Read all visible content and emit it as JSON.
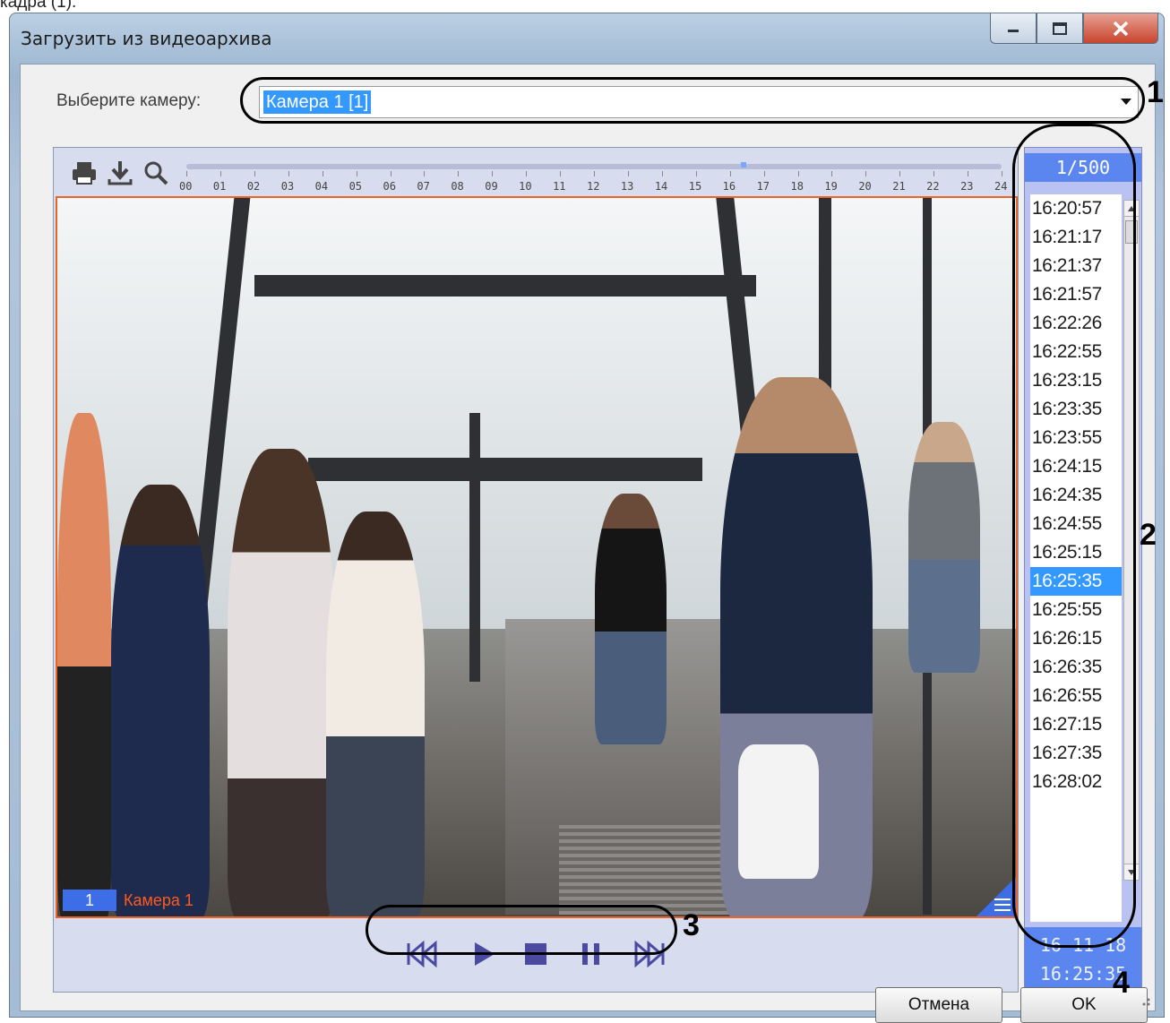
{
  "caption": "кадра (1).",
  "window": {
    "title": "Загрузить из видеоархива",
    "minimize_label": "minimize",
    "maximize_label": "maximize",
    "close_label": "close"
  },
  "camera_select": {
    "label": "Выберите камеру:",
    "value": "Камера 1 [1]"
  },
  "toolbar": {
    "icons": [
      "printer-icon",
      "download-icon",
      "zoom-icon"
    ]
  },
  "timeline": {
    "hours": [
      "00",
      "01",
      "02",
      "03",
      "04",
      "05",
      "06",
      "07",
      "08",
      "09",
      "10",
      "11",
      "12",
      "13",
      "14",
      "15",
      "16",
      "17",
      "18",
      "19",
      "20",
      "21",
      "22",
      "23",
      "24"
    ],
    "position_hour": 16.4
  },
  "video": {
    "camera_number": "1",
    "camera_name": "Камера 1"
  },
  "frames": {
    "counter": "1/500",
    "times": [
      "16:20:57",
      "16:21:17",
      "16:21:37",
      "16:21:57",
      "16:22:26",
      "16:22:55",
      "16:23:15",
      "16:23:35",
      "16:23:55",
      "16:24:15",
      "16:24:35",
      "16:24:55",
      "16:25:15",
      "16:25:35",
      "16:25:55",
      "16:26:15",
      "16:26:35",
      "16:26:55",
      "16:27:15",
      "16:27:35",
      "16:28:02"
    ],
    "selected_index": 13,
    "date": "16-11-18",
    "time": "16:25:35"
  },
  "controls": [
    "rewind-icon",
    "play-icon",
    "stop-icon",
    "pause-icon",
    "fast-forward-icon"
  ],
  "buttons": {
    "cancel": "Отмена",
    "ok": "OK"
  },
  "annotations": [
    "1",
    "2",
    "3",
    "4"
  ],
  "colors": {
    "accent": "#3399ff",
    "panel_blue": "#5b86ef",
    "video_border": "#e8642a",
    "camera_name": "#ff5a1e"
  }
}
